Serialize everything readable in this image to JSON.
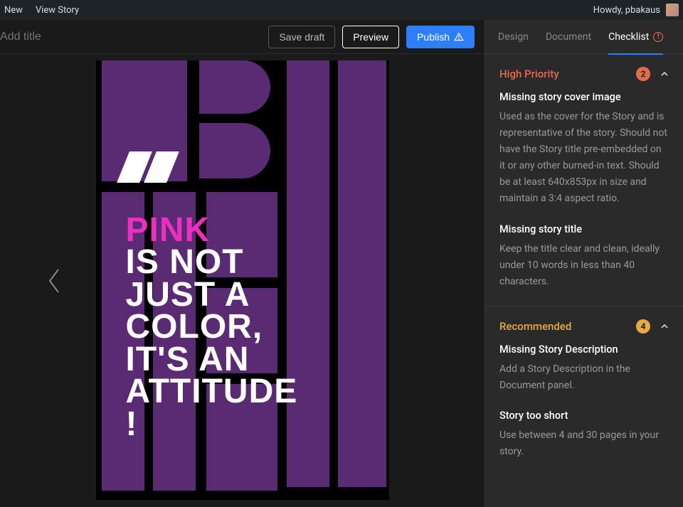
{
  "adminBar": {
    "left": [
      "New",
      "View Story"
    ],
    "greeting": "Howdy, pbakaus"
  },
  "header": {
    "titlePlaceholder": "Add title",
    "saveDraft": "Save draft",
    "preview": "Preview",
    "publish": "Publish"
  },
  "canvas": {
    "headlinePink": "PINK",
    "headlineRest": "IS NOT\nJUST A\nCOLOR,\nIT'S AN\nATTITUDE\n!"
  },
  "sidebar": {
    "tabs": {
      "design": "Design",
      "document": "Document",
      "checklist": "Checklist"
    },
    "highPriority": {
      "title": "High Priority",
      "count": "2",
      "issues": [
        {
          "title": "Missing story cover image",
          "desc": "Used as the cover for the Story and is representative of the story. Should not have the Story title pre-embedded on it or any other burned-in text. Should be at least 640x853px in size and maintain a 3:4 aspect ratio."
        },
        {
          "title": "Missing story title",
          "desc": "Keep the title clear and clean, ideally under 10 words in less than 40 characters."
        }
      ]
    },
    "recommended": {
      "title": "Recommended",
      "count": "4",
      "issues": [
        {
          "title": "Missing Story Description",
          "desc": "Add a Story Description in the Document panel."
        },
        {
          "title": "Story too short",
          "desc": "Use between 4 and 30 pages in your story."
        }
      ]
    }
  }
}
